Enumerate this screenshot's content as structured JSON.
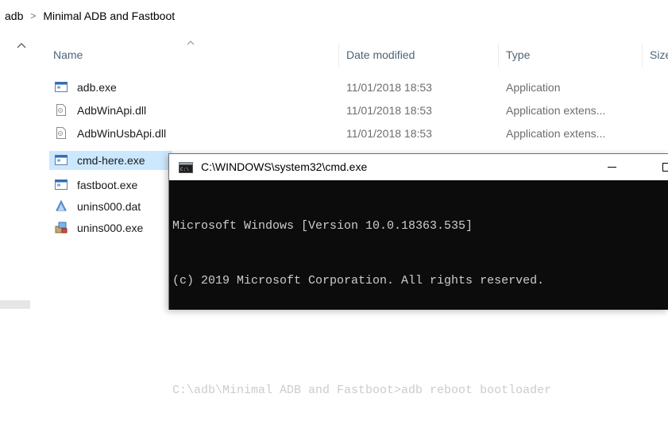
{
  "breadcrumb": {
    "items": [
      "adb",
      "Minimal ADB and Fastboot"
    ],
    "separator": ">"
  },
  "columns": {
    "name": "Name",
    "date": "Date modified",
    "type": "Type",
    "size": "Size"
  },
  "files": [
    {
      "name": "adb.exe",
      "date": "11/01/2018 18:53",
      "type": "Application",
      "icon": "exe-icon"
    },
    {
      "name": "AdbWinApi.dll",
      "date": "11/01/2018 18:53",
      "type": "Application extens...",
      "icon": "dll-icon"
    },
    {
      "name": "AdbWinUsbApi.dll",
      "date": "11/01/2018 18:53",
      "type": "Application extens...",
      "icon": "dll-icon"
    },
    {
      "name": "cmd-here.exe",
      "date": "",
      "type": "",
      "icon": "exe-icon",
      "selected": true
    },
    {
      "name": "fastboot.exe",
      "date": "",
      "type": "",
      "icon": "exe-icon"
    },
    {
      "name": "unins000.dat",
      "date": "",
      "type": "",
      "icon": "dat-icon"
    },
    {
      "name": "unins000.exe",
      "date": "",
      "type": "",
      "icon": "installer-icon"
    }
  ],
  "cmd": {
    "title": "C:\\WINDOWS\\system32\\cmd.exe",
    "lines": [
      "Microsoft Windows [Version 10.0.18363.535]",
      "(c) 2019 Microsoft Corporation. All rights reserved.",
      "",
      "C:\\adb\\Minimal ADB and Fastboot>adb reboot bootloader"
    ]
  },
  "colors": {
    "selected_row": "#cce8ff",
    "header_text": "#4d6479",
    "console_bg": "#0c0c0c",
    "console_text": "#cccccc"
  }
}
